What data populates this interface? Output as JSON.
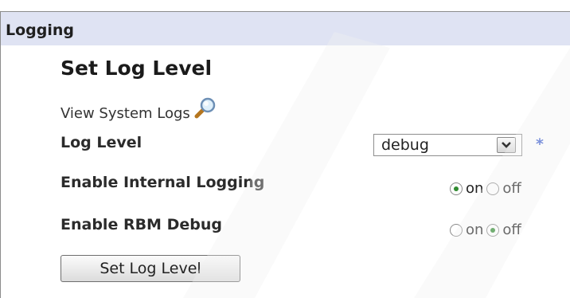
{
  "panel": {
    "title": "Logging"
  },
  "section": {
    "title": "Set Log Level"
  },
  "view_logs": {
    "label": "View System Logs",
    "icon": "magnifier-icon"
  },
  "log_level": {
    "label": "Log Level",
    "value": "debug",
    "required_marker": "*"
  },
  "internal_logging": {
    "label": "Enable Internal Logging",
    "on_label": "on",
    "off_label": "off",
    "selected": "on"
  },
  "rbm_debug": {
    "label": "Enable RBM Debug",
    "on_label": "on",
    "off_label": "off",
    "selected": "off"
  },
  "submit": {
    "label": "Set Log Level"
  },
  "colors": {
    "header_bg": "#dfe3f3",
    "required": "#3d5fd0",
    "radio_dot": "#2f8a2f"
  }
}
